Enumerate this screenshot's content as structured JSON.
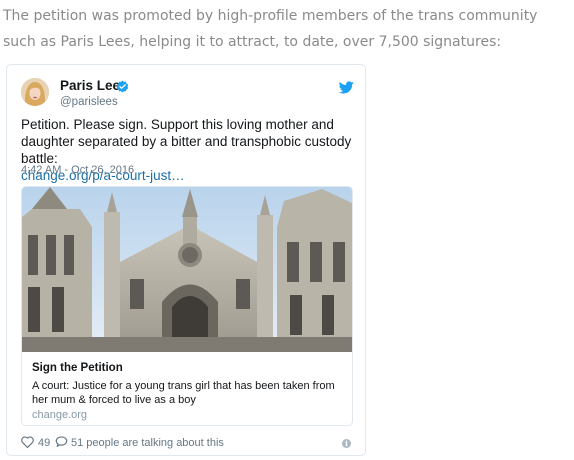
{
  "article": {
    "paragraph": "The petition was promoted by high-profile members of the trans community such as Paris Lees, helping it to attract, to date, over 7,500 signatures:"
  },
  "tweet": {
    "author_name": "Paris Lees",
    "author_handle": "@parislees",
    "text": "Petition. Please sign. Support this loving mother and daughter separated by a bitter and transphobic custody battle:",
    "link": "change.org/p/a-court-just…",
    "timestamp": "4:42 AM - Oct 26, 2016",
    "verified_icon": "verified-badge-icon",
    "brand_icon": "twitter-bird-icon",
    "colors": {
      "brand": "#1da1f2",
      "link": "#1b6fa8",
      "meta": "#657786",
      "border": "#e1e8ed"
    },
    "card": {
      "image": "royal-courts-of-justice-building-image",
      "title": "Sign the Petition",
      "description": "A court: Justice for a young trans girl that has been taken from her mum & forced to live as a boy",
      "domain": "change.org"
    },
    "footer": {
      "likes": "49",
      "talking": "51 people are talking about this",
      "like_icon": "heart-icon",
      "reply_icon": "reply-bubble-icon",
      "info_icon": "info-icon"
    }
  }
}
